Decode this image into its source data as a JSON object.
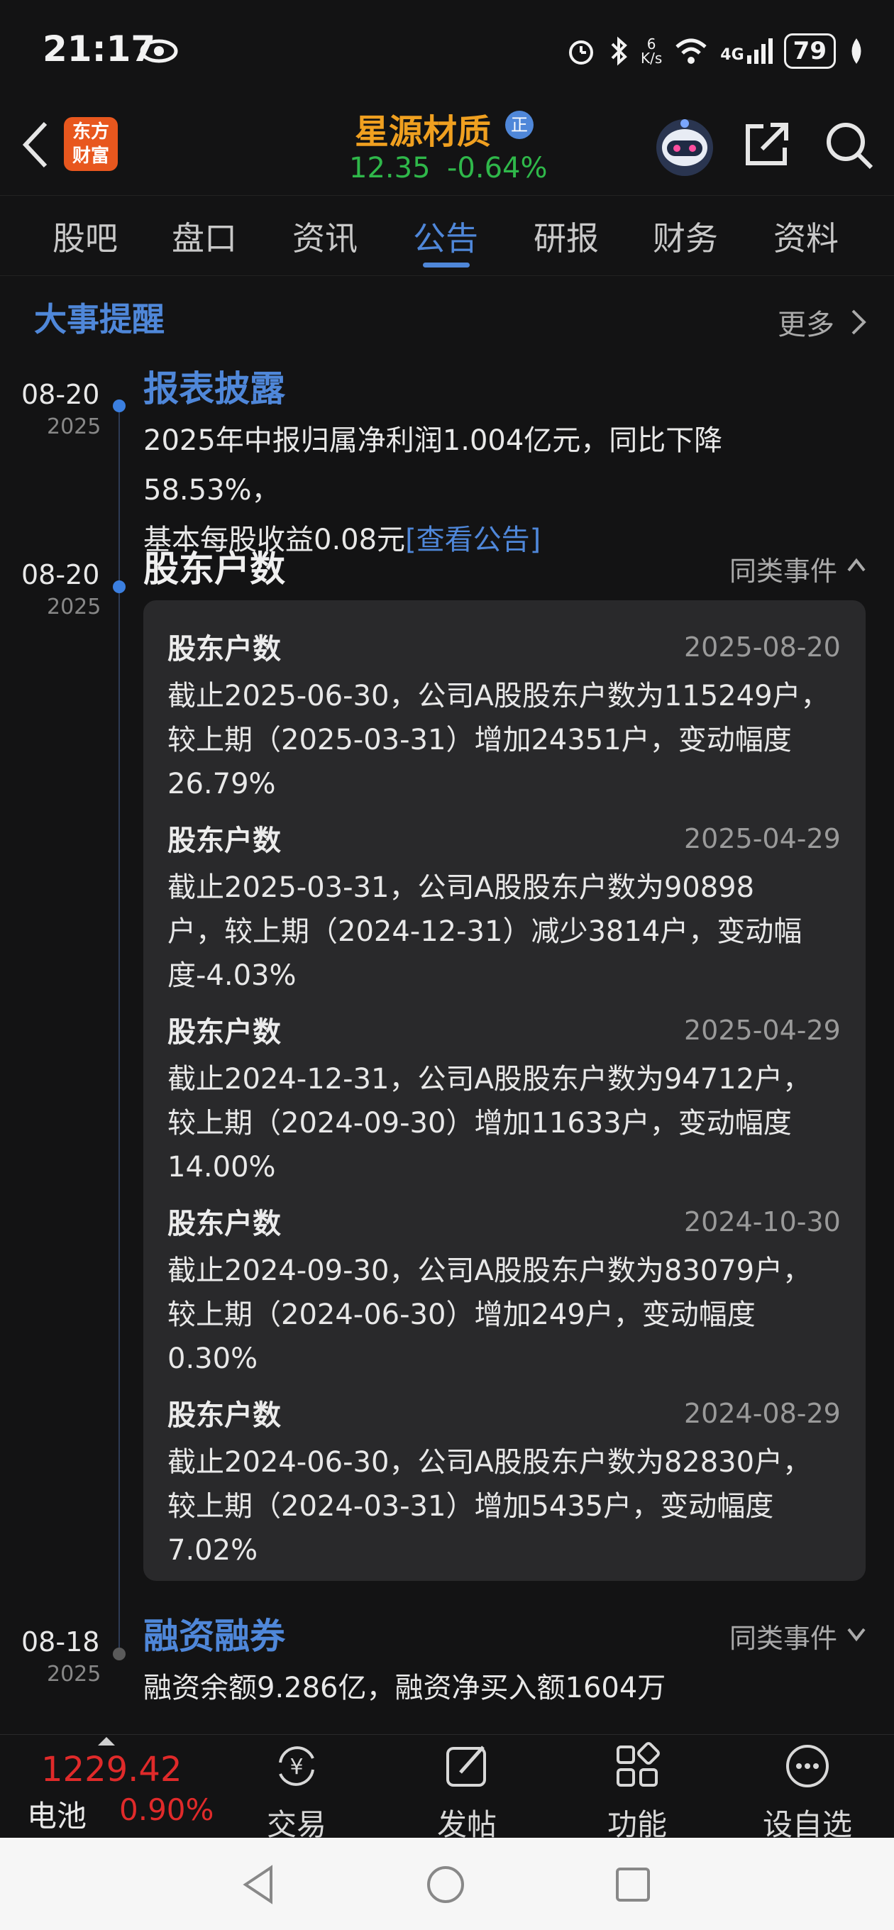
{
  "status_bar": {
    "time": "21:17",
    "net_speed_top": "6",
    "net_speed_unit": "K/s",
    "signal_label": "4G",
    "battery": "79"
  },
  "header": {
    "logo_line1": "东方",
    "logo_line2": "财富",
    "stock_name": "星源材质",
    "badge": "正",
    "price": "12.35",
    "change_pct": "-0.64%",
    "colors": {
      "name": "#f0a020",
      "price": "#2fb84a",
      "accent": "#4f87d9"
    }
  },
  "tabs": [
    "股吧",
    "盘口",
    "资讯",
    "公告",
    "研报",
    "财务",
    "资料"
  ],
  "active_tab": "公告",
  "section": {
    "title": "大事提醒",
    "more_label": "更多"
  },
  "events": [
    {
      "date_md": "08-20",
      "year": "2025",
      "title": "报表披露",
      "text_line1": "2025年中报归属净利润1.004亿元，同比下降58.53%，",
      "text_line2": "基本每股收益0.08元",
      "link": "[查看公告]"
    },
    {
      "date_md": "08-20",
      "year": "2025",
      "title": "股东户数",
      "similar_label": "同类事件",
      "items": [
        {
          "title": "股东户数",
          "date": "2025-08-20",
          "line1": "截止2025-06-30，公司A股股东户数为115249户，",
          "line2": "较上期（2025-03-31）增加24351户，变动幅度",
          "line3": "26.79%"
        },
        {
          "title": "股东户数",
          "date": "2025-04-29",
          "line1": "截止2025-03-31，公司A股股东户数为90898",
          "line2": "户，较上期（2024-12-31）减少3814户，变动幅",
          "line3": "度-4.03%"
        },
        {
          "title": "股东户数",
          "date": "2025-04-29",
          "line1": "截止2024-12-31，公司A股股东户数为94712户，",
          "line2": "较上期（2024-09-30）增加11633户，变动幅度",
          "line3": "14.00%"
        },
        {
          "title": "股东户数",
          "date": "2024-10-30",
          "line1": "截止2024-09-30，公司A股股东户数为83079户，",
          "line2": "较上期（2024-06-30）增加249户，变动幅度",
          "line3": "0.30%"
        },
        {
          "title": "股东户数",
          "date": "2024-08-29",
          "line1": "截止2024-06-30，公司A股股东户数为82830户，",
          "line2": "较上期（2024-03-31）增加5435户，变动幅度",
          "line3": "7.02%"
        }
      ]
    },
    {
      "date_md": "08-18",
      "year": "2025",
      "title": "融资融券",
      "similar_label": "同类事件",
      "text_line1": "融资余额9.286亿，融资净买入额1604万"
    }
  ],
  "bottom_bar": {
    "index_value": "1229.42",
    "index_name": "电池",
    "index_pct": "0.90%",
    "nav": [
      "交易",
      "发帖",
      "功能",
      "设自选"
    ]
  }
}
